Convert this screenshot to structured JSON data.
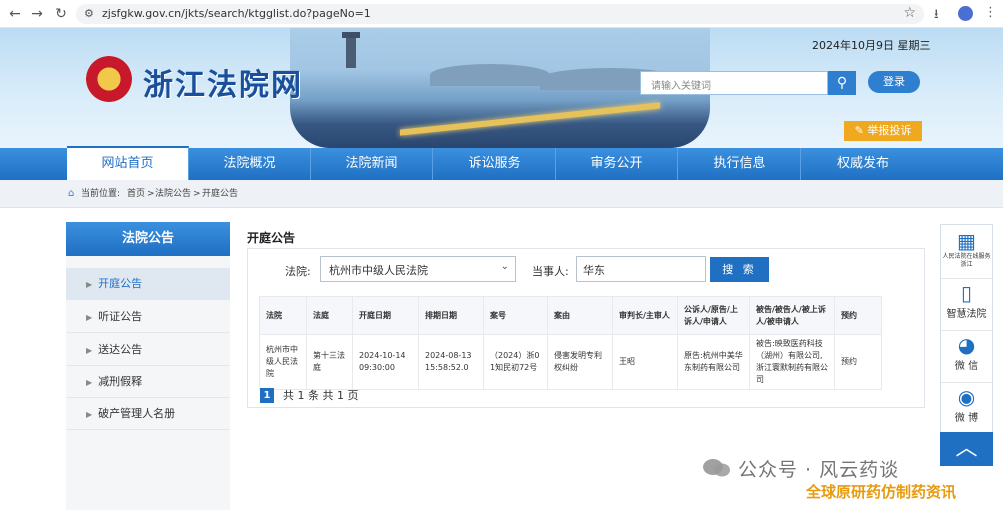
{
  "browser": {
    "url": "zjsfgkw.gov.cn/jkts/search/ktgglist.do?pageNo=1"
  },
  "header": {
    "site_title": "浙江法院网",
    "date": "2024年10月9日  星期三",
    "search_placeholder": "请输入关键词",
    "login_label": "登录",
    "report_label": "举报投诉"
  },
  "nav": {
    "items": [
      "网站首页",
      "法院概况",
      "法院新闻",
      "诉讼服务",
      "审务公开",
      "执行信息",
      "权威发布"
    ]
  },
  "breadcrumb": {
    "label": "当前位置:",
    "items": [
      "首页",
      "法院公告",
      "开庭公告"
    ],
    "sep": ">"
  },
  "sidebar": {
    "title": "法院公告",
    "items": [
      "开庭公告",
      "听证公告",
      "送达公告",
      "减刑假释",
      "破产管理人名册"
    ]
  },
  "content": {
    "title": "开庭公告",
    "court_label": "法院:",
    "court_value": "杭州市中级人民法院",
    "party_label": "当事人:",
    "party_value": "华东",
    "search_label": "搜 索",
    "table": {
      "headers": [
        "法院",
        "法庭",
        "开庭日期",
        "排期日期",
        "案号",
        "案由",
        "审判长/主审人",
        "公诉人/原告/上诉人/申请人",
        "被告/被告人/被上诉人/被申请人",
        "预约"
      ],
      "rows": [
        [
          "杭州市中级人民法院",
          "第十三法庭",
          "2024-10-14 09:30:00",
          "2024-08-13 15:58:52.0",
          "（2024）浙01知民初72号",
          "侵害发明专利权纠纷",
          "王昭",
          "原告:杭州中美华东制药有限公司",
          "被告:映致医药科技（湖州）有限公司,浙江寰默制药有限公司",
          "预约"
        ]
      ]
    },
    "pager": {
      "current": "1",
      "summary": "共 1 条 共 1 页"
    }
  },
  "right_tools": {
    "items": [
      {
        "label": "人民法院在线服务浙江",
        "icon": "qr-code-icon"
      },
      {
        "label": "智慧法院",
        "icon": "phone-icon"
      },
      {
        "label": "微 信",
        "icon": "wechat-icon"
      },
      {
        "label": "微 博",
        "icon": "weibo-icon"
      }
    ]
  },
  "watermark": {
    "line1": "公众号 · 风云药谈",
    "line2": "全球原研药仿制药资讯"
  }
}
